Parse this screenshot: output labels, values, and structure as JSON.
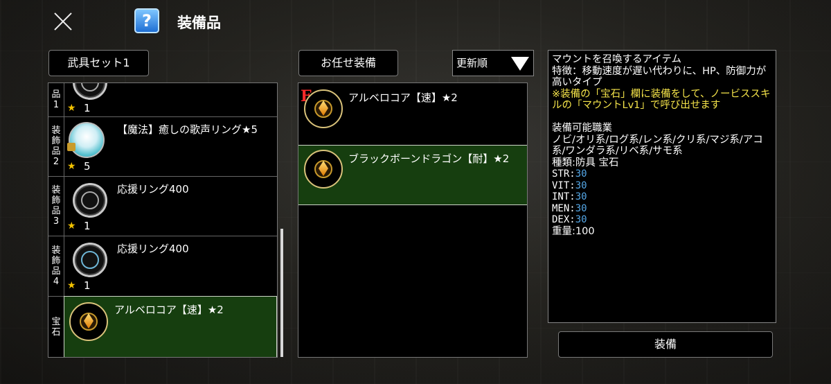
{
  "header": {
    "title": "装備品",
    "help_icon_text": "?"
  },
  "left": {
    "weapon_set_label": "武具セット1",
    "slots": [
      {
        "label": "品1",
        "count": "1",
        "name": ""
      },
      {
        "label": "装飾品2",
        "count": "5",
        "name": "【魔法】癒しの歌声リング★5"
      },
      {
        "label": "装飾品3",
        "count": "1",
        "name": "応援リング400"
      },
      {
        "label": "装飾品4",
        "count": "1",
        "name": "応援リング400"
      },
      {
        "label": "宝石",
        "count": "",
        "name": "アルベロコア【速】★2"
      }
    ]
  },
  "middle": {
    "auto_equip_label": "お任せ装備",
    "sort_label": "更新順",
    "items": [
      {
        "equipped_mark": "E",
        "name": "アルベロコア【速】★2"
      },
      {
        "equipped_mark": "",
        "name": "ブラックボーンドラゴン【耐】★2"
      }
    ]
  },
  "description": {
    "intro": "マウントを召喚するアイテム\n特徴：移動速度が遅い代わりに、HP、防御力が高いタイプ",
    "note": "※装備の「宝石」欄に装備をして、ノービススキルの「マウントLv1」で呼び出せます",
    "jobs": "装備可能職業\nノビ/オリ系/ログ系/レン系/クリ系/マジ系/アコ系/ワンダラ系/リベ系/サモ系\n種類:防具 宝石",
    "stats": [
      {
        "k": "STR:",
        "v": "30"
      },
      {
        "k": "VIT:",
        "v": "30"
      },
      {
        "k": "INT:",
        "v": "30"
      },
      {
        "k": "MEN:",
        "v": "30"
      },
      {
        "k": "DEX:",
        "v": "30"
      }
    ],
    "weight": "重量:100"
  },
  "equip_button_label": "装備",
  "icons": {
    "close": "close-icon",
    "help": "help-icon",
    "sort": "dropdown-triangle-icon",
    "star": "star-icon"
  },
  "colors": {
    "selected": "#163e0f",
    "star": "#f2c200",
    "note": "#f5e44a",
    "stat_value": "#55a8e8",
    "equipped": "#ff2a2a"
  }
}
